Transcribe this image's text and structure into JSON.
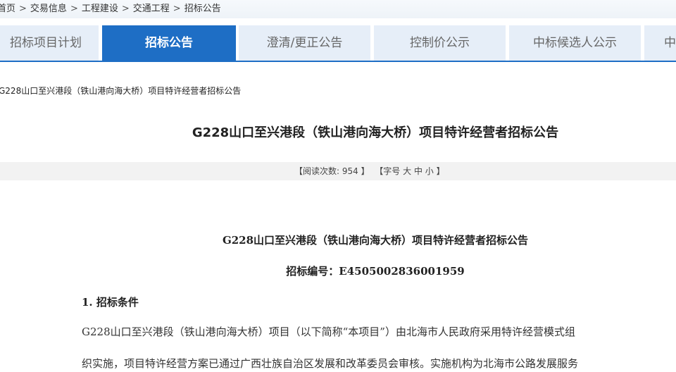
{
  "breadcrumb": {
    "items": [
      "首页",
      "交易信息",
      "工程建设",
      "交通工程",
      "招标公告"
    ],
    "separator": ">"
  },
  "tabs": [
    {
      "label": "招标项目计划",
      "active": false
    },
    {
      "label": "招标公告",
      "active": true
    },
    {
      "label": "澄清/更正公告",
      "active": false
    },
    {
      "label": "控制价公示",
      "active": false
    },
    {
      "label": "中标候选人公示",
      "active": false
    },
    {
      "label": "中",
      "active": false
    }
  ],
  "sub_crumb": "G228山口至兴港段（铁山港向海大桥）项目特许经营者招标公告",
  "page_title": "G228山口至兴港段（铁山港向海大桥）项目特许经营者招标公告",
  "info_bar": {
    "read_label": "【阅读次数:",
    "read_count": "954",
    "read_close": "】",
    "font_label": "【字号",
    "font_large": "大",
    "font_medium": "中",
    "font_small": "小",
    "font_close": "】"
  },
  "document": {
    "title": "G228山口至兴港段（铁山港向海大桥）项目特许经营者招标公告",
    "number": "招标编号：E4505002836001959",
    "section1_heading": "1. 招标条件",
    "paragraph_line1": "G228山口至兴港段（铁山港向海大桥）项目（以下简称“本项目”）由北海市人民政府采用特许经营模式组",
    "paragraph_line2": "织实施，项目特许经营方案已通过广西壮族自治区发展和改革委员会审核。实施机构为北海市公路发展服务"
  },
  "colors": {
    "accent": "#1e6ec5",
    "tab_inactive_bg": "#e6eef8",
    "info_bar_bg": "#f2f2f2"
  }
}
